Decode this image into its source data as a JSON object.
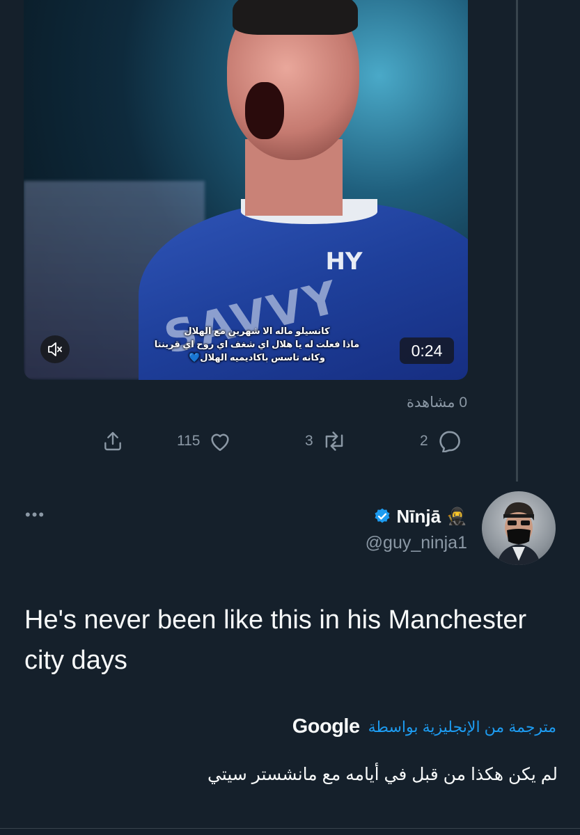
{
  "video": {
    "caption_lines": [
      "كانسيلو ماله الا شهرين مع الهلال",
      "ماذا فعلت له يا هلال اي شغف اي روح اي قرينتا",
      "وكانه تاسس باكاديميه الهلال💙"
    ],
    "crest_text": "HY",
    "sponsor_text": "SAVVY",
    "duration": "0:24",
    "mute_icon": "speaker-muted-icon"
  },
  "quoted_tweet": {
    "views": "0 مشاهدة",
    "actions": {
      "replies": "2",
      "retweets": "3",
      "likes": "115"
    }
  },
  "reply": {
    "author_name": "Nīnjā",
    "author_emoji": "🥷",
    "handle": "@guy_ninja1",
    "text": "He's never been like this in his Manchester city days",
    "translation": {
      "label": "مترجمة من الإنجليزية بواسطة",
      "provider": "Google",
      "text": "لم يكن هكذا من قبل في أيامه مع مانشستر سيتي"
    },
    "more_icon": "•••"
  },
  "colors": {
    "background": "#15202b",
    "text_primary": "#f7f9f9",
    "text_secondary": "#8b98a5",
    "accent": "#1d9bf0",
    "divider": "#38444d"
  }
}
